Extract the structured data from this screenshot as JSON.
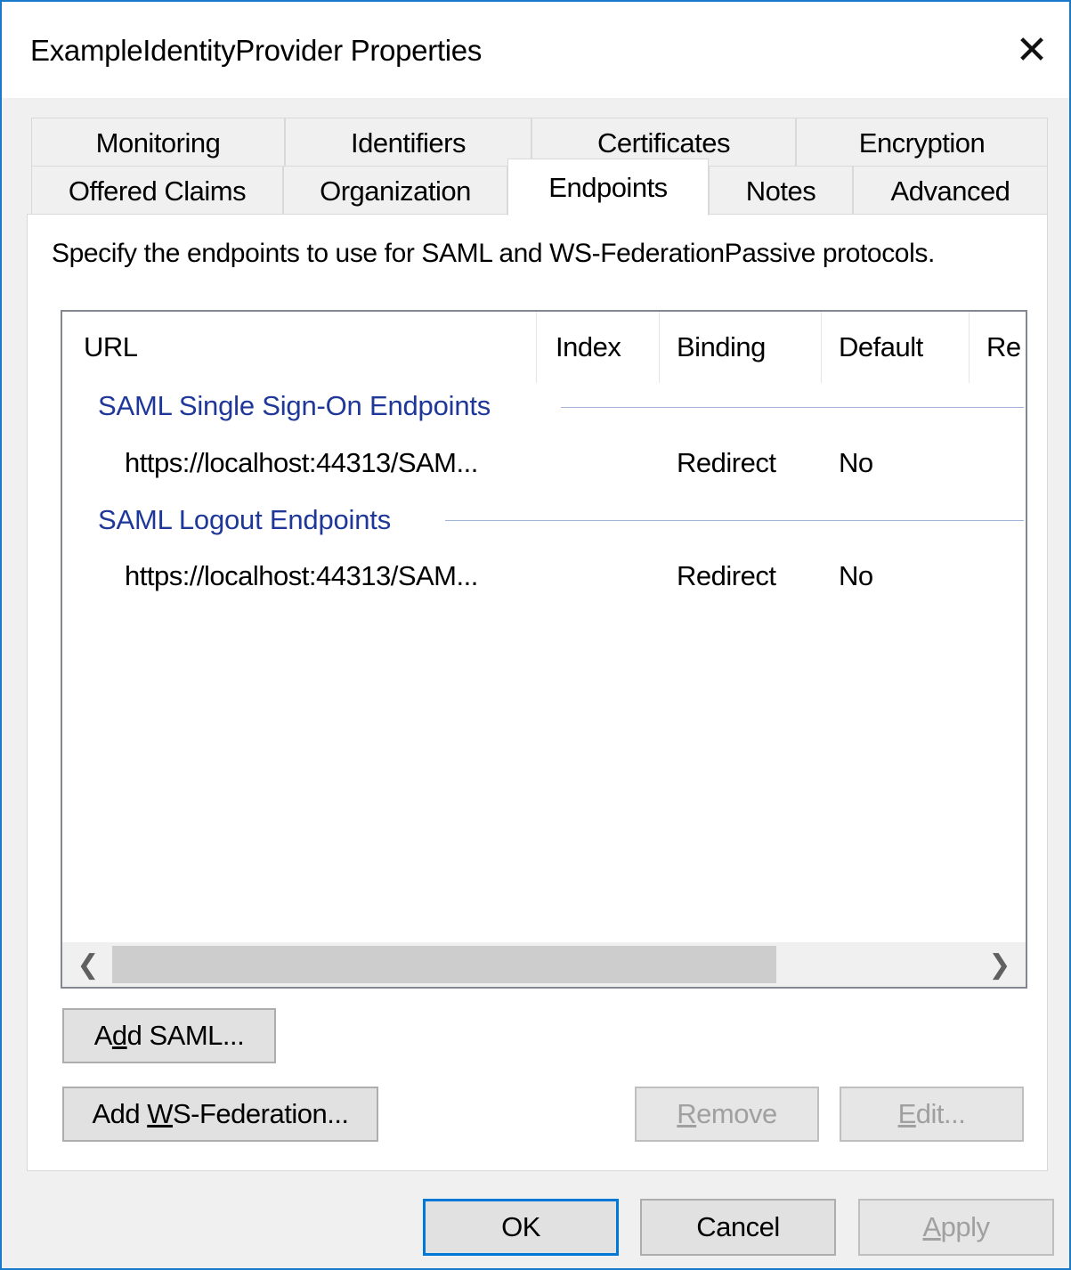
{
  "window": {
    "title": "ExampleIdentityProvider Properties",
    "close_glyph": "✕"
  },
  "tabs": {
    "row1": [
      "Monitoring",
      "Identifiers",
      "Certificates",
      "Encryption"
    ],
    "row2": [
      "Offered Claims",
      "Organization",
      "Endpoints",
      "Notes",
      "Advanced"
    ],
    "selected": "Endpoints"
  },
  "instructions": "Specify the endpoints to use for SAML and WS-FederationPassive protocols.",
  "list": {
    "columns": [
      "URL",
      "Index",
      "Binding",
      "Default",
      "Re"
    ],
    "groups": [
      {
        "name": "SAML Single Sign-On Endpoints",
        "rows": [
          {
            "url": "https://localhost:44313/SAM...",
            "index": "",
            "binding": "Redirect",
            "default": "No"
          }
        ]
      },
      {
        "name": "SAML Logout Endpoints",
        "rows": [
          {
            "url": "https://localhost:44313/SAM...",
            "index": "",
            "binding": "Redirect",
            "default": "No"
          }
        ]
      }
    ],
    "scroll_left_glyph": "❮",
    "scroll_right_glyph": "❯"
  },
  "buttons": {
    "add_saml": {
      "pre": "A",
      "mnemonic": "d",
      "post": "d SAML..."
    },
    "add_wsfed": {
      "pre": "Add ",
      "mnemonic": "W",
      "post": "S-Federation..."
    },
    "remove": {
      "pre": "",
      "mnemonic": "R",
      "post": "emove"
    },
    "edit": {
      "pre": "",
      "mnemonic": "E",
      "post": "dit..."
    },
    "ok": "OK",
    "cancel": "Cancel",
    "apply": {
      "pre": "",
      "mnemonic": "A",
      "post": "pply"
    }
  },
  "colors": {
    "accent": "#0078d7",
    "window_border": "#1979ca",
    "group_header": "#1e3799",
    "disabled_text": "#a0a0a0"
  },
  "icons": [
    "close-icon",
    "chevron-left-icon",
    "chevron-right-icon"
  ]
}
